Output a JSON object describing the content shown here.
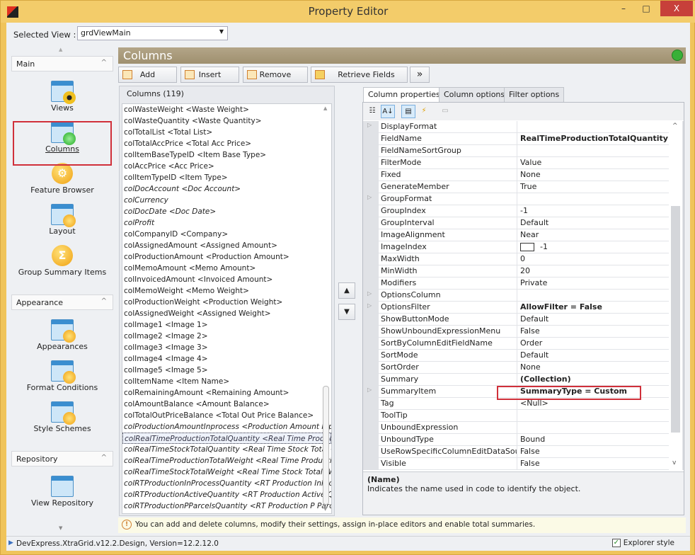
{
  "window": {
    "title": "Property Editor",
    "minimize": "–",
    "maximize": "□",
    "close": "X"
  },
  "selected_view": {
    "label": "Selected View :",
    "value": "grdViewMain"
  },
  "sidebar": {
    "groups": [
      {
        "label": "Main"
      },
      {
        "label": "Appearance"
      },
      {
        "label": "Repository"
      }
    ],
    "items": [
      {
        "label": "Views",
        "icon": "views-icon"
      },
      {
        "label": "Columns",
        "icon": "columns-icon",
        "selected": true
      },
      {
        "label": "Feature Browser",
        "icon": "feature-browser-icon"
      },
      {
        "label": "Layout",
        "icon": "layout-icon"
      },
      {
        "label": "Group Summary Items",
        "icon": "group-summary-icon"
      },
      {
        "label": "Appearances",
        "icon": "appearances-icon"
      },
      {
        "label": "Format Conditions",
        "icon": "format-conditions-icon"
      },
      {
        "label": "Style Schemes",
        "icon": "style-schemes-icon"
      },
      {
        "label": "View Repository",
        "icon": "view-repository-icon"
      }
    ]
  },
  "section": {
    "title": "Columns"
  },
  "toolbar": {
    "add": "Add",
    "insert": "Insert",
    "remove": "Remove",
    "retrieve": "Retrieve Fields",
    "more": "»"
  },
  "columns": {
    "header": "Columns (119)",
    "items": [
      {
        "t": "colWasteWeight <Waste Weight>"
      },
      {
        "t": "colWasteQuantity <Waste Quantity>"
      },
      {
        "t": "colTotalList <Total List>"
      },
      {
        "t": "colTotalAccPrice <Total Acc Price>"
      },
      {
        "t": "colItemBaseTypeID <Item Base Type>"
      },
      {
        "t": "colAccPrice <Acc Price>"
      },
      {
        "t": "colItemTypeID <Item Type>"
      },
      {
        "t": "colDocAccount <Doc Account>",
        "i": true
      },
      {
        "t": "colCurrency",
        "i": true
      },
      {
        "t": "colDocDate <Doc Date>",
        "i": true
      },
      {
        "t": "colProfit",
        "i": true
      },
      {
        "t": "colCompanyID <Company>"
      },
      {
        "t": "colAssignedAmount <Assigned Amount>"
      },
      {
        "t": "colProductionAmount <Production Amount>"
      },
      {
        "t": "colMemoAmount <Memo Amount>"
      },
      {
        "t": "colInvoicedAmount <Invoiced Amount>"
      },
      {
        "t": "colMemoWeight <Memo Weight>"
      },
      {
        "t": "colProductionWeight <Production Weight>"
      },
      {
        "t": "colAssignedWeight <Assigned Weight>"
      },
      {
        "t": "colImage1 <Image 1>"
      },
      {
        "t": "colImage2 <Image 2>"
      },
      {
        "t": "colImage3 <Image 3>"
      },
      {
        "t": "colImage4 <Image 4>"
      },
      {
        "t": "colImage5 <Image 5>"
      },
      {
        "t": "colItemName <Item Name>"
      },
      {
        "t": "colRemainingAmount <Remaining Amount>"
      },
      {
        "t": "colAmountBalance <Amount Balance>"
      },
      {
        "t": "colTotalOutPriceBalance <Total Out Price Balance>"
      },
      {
        "t": "colProductionAmountInprocess <Production Amount Inprc",
        "i": true
      },
      {
        "t": "colRealTimeProductionTotalQuantity <Real Time Productic",
        "i": true,
        "sel": true
      },
      {
        "t": "colRealTimeStockTotalQuantity <Real Time Stock Total Qu",
        "i": true
      },
      {
        "t": "colRealTimeProductionTotalWeight <Real Time Production",
        "i": true
      },
      {
        "t": "colRealTimeStockTotalWeight <Real Time Stock Total Wei",
        "i": true
      },
      {
        "t": "colRTProductionInProcessQuantity <RT Production InProc",
        "i": true
      },
      {
        "t": "colRTProductionActiveQuantity <RT Production Active Qu",
        "i": true
      },
      {
        "t": "colRTProductionPParcelsQuantity <RT Production P Parce",
        "i": true
      }
    ]
  },
  "move": {
    "up": "▲",
    "down": "▼"
  },
  "tabs": [
    {
      "label": "Column properties",
      "active": true
    },
    {
      "label": "Column options"
    },
    {
      "label": "Filter options"
    }
  ],
  "properties": [
    {
      "n": "DisplayFormat",
      "v": "",
      "e": true
    },
    {
      "n": "FieldName",
      "v": "RealTimeProductionTotalQuantity",
      "b": true
    },
    {
      "n": "FieldNameSortGroup",
      "v": ""
    },
    {
      "n": "FilterMode",
      "v": "Value"
    },
    {
      "n": "Fixed",
      "v": "None"
    },
    {
      "n": "GenerateMember",
      "v": "True"
    },
    {
      "n": "GroupFormat",
      "v": "",
      "e": true
    },
    {
      "n": "GroupIndex",
      "v": "-1"
    },
    {
      "n": "GroupInterval",
      "v": "Default"
    },
    {
      "n": "ImageAlignment",
      "v": "Near"
    },
    {
      "n": "ImageIndex",
      "v": "-1",
      "sw": true
    },
    {
      "n": "MaxWidth",
      "v": "0"
    },
    {
      "n": "MinWidth",
      "v": "20"
    },
    {
      "n": "Modifiers",
      "v": "Private"
    },
    {
      "n": "OptionsColumn",
      "v": "",
      "e": true
    },
    {
      "n": "OptionsFilter",
      "v": "AllowFilter = False",
      "b": true,
      "e": true
    },
    {
      "n": "ShowButtonMode",
      "v": "Default"
    },
    {
      "n": "ShowUnboundExpressionMenu",
      "v": "False"
    },
    {
      "n": "SortByColumnEditFieldName",
      "v": "Order"
    },
    {
      "n": "SortMode",
      "v": "Default"
    },
    {
      "n": "SortOrder",
      "v": "None"
    },
    {
      "n": "Summary",
      "v": "(Collection)",
      "b": true
    },
    {
      "n": "SummaryItem",
      "v": "SummaryType = Custom",
      "b": true,
      "e": true
    },
    {
      "n": "Tag",
      "v": "<Null>"
    },
    {
      "n": "ToolTip",
      "v": ""
    },
    {
      "n": "UnboundExpression",
      "v": ""
    },
    {
      "n": "UnboundType",
      "v": "Bound"
    },
    {
      "n": "UseRowSpecificColumnEditDataSourceFi",
      "v": "False"
    },
    {
      "n": "Visible",
      "v": "False"
    }
  ],
  "description": {
    "title": "(Name)",
    "text": "Indicates the name used in code to identify the object."
  },
  "hint": "You can add and delete columns, modify their settings, assign in-place editors and enable total summaries.",
  "status": {
    "version": "DevExpress.XtraGrid.v12.2.Design, Version=12.2.12.0",
    "explorer_style": "Explorer style",
    "explorer_checked": true
  },
  "colors": {
    "highlight": "#d0303a",
    "header": "#a89a7a",
    "titlebar": "#f3cc6a"
  }
}
